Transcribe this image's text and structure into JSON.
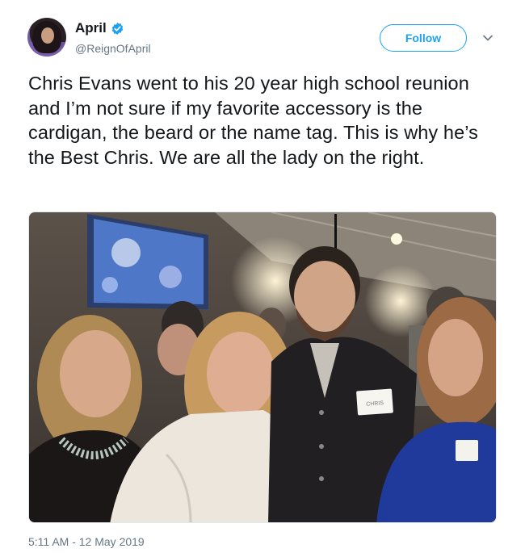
{
  "tweet": {
    "author": {
      "display_name": "April",
      "handle": "@ReignOfApril",
      "verified": true,
      "avatar_icon": "user-avatar"
    },
    "follow_label": "Follow",
    "menu_icon": "chevron-down-icon",
    "text": "Chris Evans went to his 20 year high school reunion and I’m not sure if my favorite accessory is the cardigan, the beard or the name tag. This is why he’s the Best Chris. We are all the lady on the right.",
    "photo": {
      "name_tag_text": "CHRIS"
    },
    "timestamp": "5:11 AM - 12 May 2019"
  },
  "colors": {
    "accent": "#1da1f2",
    "text": "#14171a",
    "secondary_text": "#657786"
  }
}
